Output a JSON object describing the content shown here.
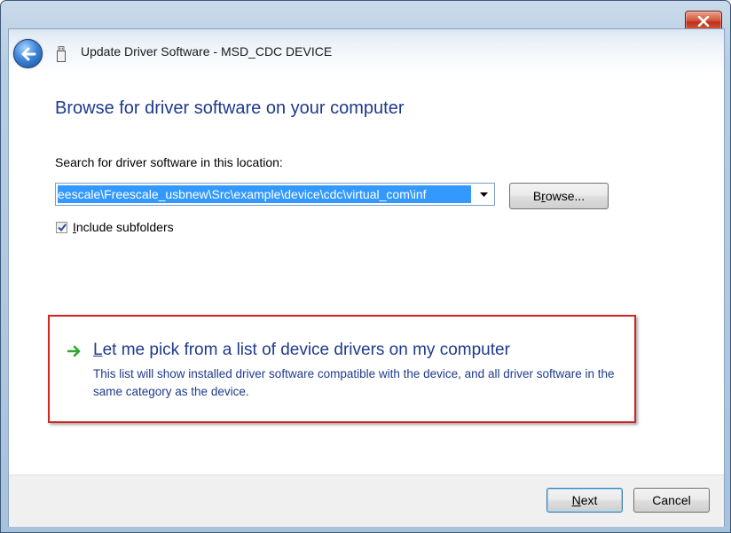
{
  "window": {
    "title": "Update Driver Software - MSD_CDC DEVICE",
    "close_glyph": "✕"
  },
  "main": {
    "heading": "Browse for driver software on your computer",
    "search_label": "Search for driver software in this location:",
    "path_value": "eescale\\Freescale_usbnew\\Src\\example\\device\\cdc\\virtual_com\\inf",
    "browse": {
      "accel": "r",
      "before": "B",
      "after": "owse..."
    },
    "include_subfolders": {
      "accel": "I",
      "rest": "nclude subfolders",
      "checked": true
    },
    "pick": {
      "accel": "L",
      "title_rest": "et me pick from a list of device drivers on my computer",
      "description": "This list will show installed driver software compatible with the device, and all driver software in the same category as the device."
    }
  },
  "footer": {
    "next": {
      "accel": "N",
      "rest": "ext"
    },
    "cancel_label": "Cancel"
  },
  "colors": {
    "heading_blue": "#1e3a8c",
    "highlight": "#3399ff",
    "annotation_red": "#d4241f",
    "arrow_green": "#2fa52f"
  },
  "icons": [
    "close-icon",
    "back-arrow-icon",
    "usb-device-icon",
    "dropdown-arrow-icon",
    "checkmark-icon",
    "green-arrow-icon"
  ]
}
